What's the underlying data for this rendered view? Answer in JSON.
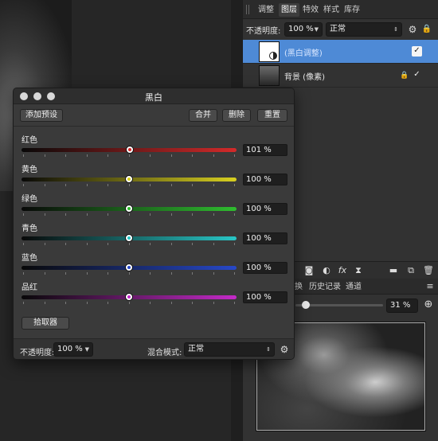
{
  "panel_tabs": [
    "调整",
    "图层",
    "特效",
    "样式",
    "库存"
  ],
  "panel_active_tab": "图层",
  "layer_options": {
    "opacity_label": "不透明度:",
    "opacity_value": "100 %",
    "blend_value": "正常"
  },
  "layers": [
    {
      "name": "(黑白调整)",
      "selected": true
    },
    {
      "name": "背景 (像素)",
      "selected": false
    }
  ],
  "nav_tabs": [
    "换",
    "历史记录",
    "通道"
  ],
  "nav_zoom": "31 %",
  "dialog": {
    "title": "黑白",
    "buttons": {
      "add_preset": "添加预设",
      "merge": "合并",
      "delete": "删除",
      "reset": "重置",
      "picker": "拾取器"
    },
    "channels": [
      {
        "label": "红色",
        "value": "101 %",
        "color": "#d42a2a",
        "level": 0.505
      },
      {
        "label": "黄色",
        "value": "100 %",
        "color": "#d8d020",
        "level": 0.5
      },
      {
        "label": "绿色",
        "value": "100 %",
        "color": "#2fbd2f",
        "level": 0.5
      },
      {
        "label": "青色",
        "value": "100 %",
        "color": "#28c6c6",
        "level": 0.5
      },
      {
        "label": "蓝色",
        "value": "100 %",
        "color": "#2748c8",
        "level": 0.5
      },
      {
        "label": "品红",
        "value": "100 %",
        "color": "#c42ac8",
        "level": 0.5
      }
    ],
    "footer": {
      "opacity_label": "不透明度:",
      "opacity_value": "100 %",
      "blend_label": "混合模式:",
      "blend_value": "正常"
    }
  },
  "colors": {
    "accent": "#4e8ad6"
  },
  "icons": {
    "layer_toolbar": [
      "mask-icon",
      "adjustment-icon",
      "fx-icon",
      "live-filter-icon",
      "folder-icon",
      "add-layer-icon",
      "trash-icon"
    ],
    "gear": "gear-icon",
    "lock": "lock-icon",
    "check": "check-icon"
  }
}
